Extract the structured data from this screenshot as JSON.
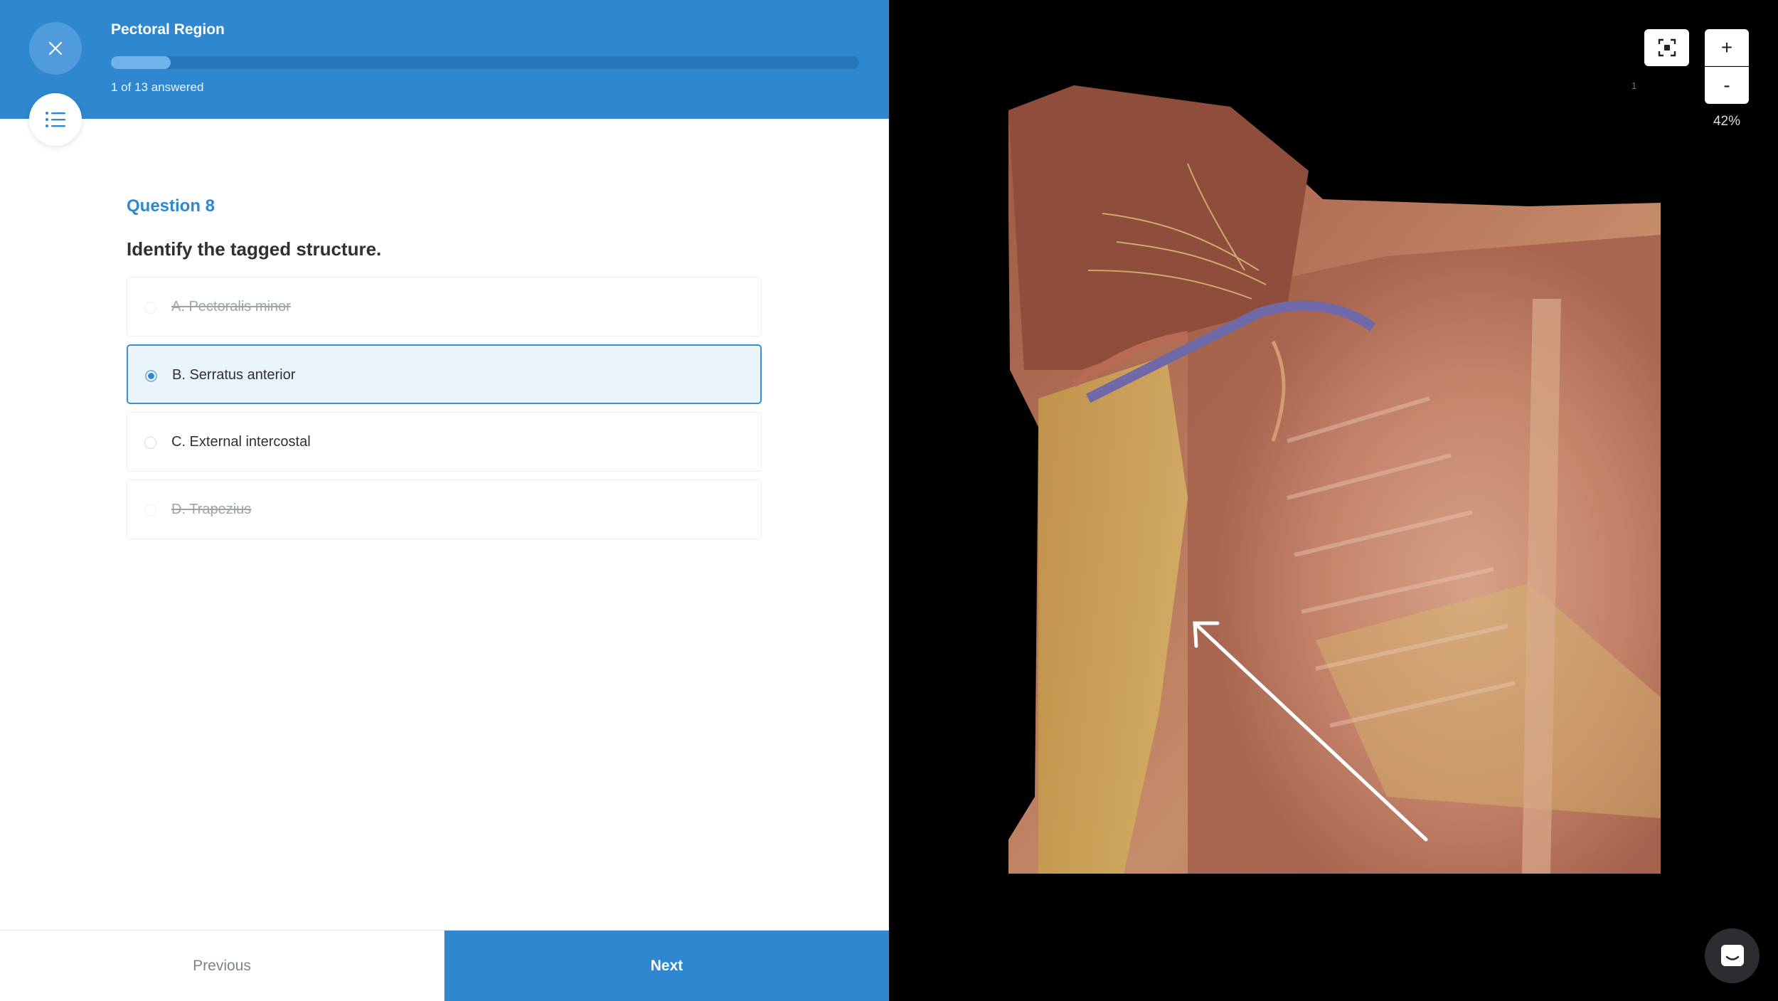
{
  "header": {
    "title": "Pectoral Region",
    "progress_text": "1 of 13 answered",
    "progress_fraction": 0.08
  },
  "question": {
    "number": "Question 8",
    "prompt": "Identify the tagged structure."
  },
  "options": [
    {
      "label": "A. Pectoralis minor",
      "state": "struck"
    },
    {
      "label": "B. Serratus anterior",
      "state": "selected"
    },
    {
      "label": "C. External intercostal",
      "state": "normal"
    },
    {
      "label": "D. Trapezius",
      "state": "struck"
    }
  ],
  "footer": {
    "previous_label": "Previous",
    "next_label": "Next"
  },
  "viewer": {
    "zoom_in_label": "+",
    "zoom_out_label": "-",
    "zoom_level": "42%",
    "page_indicator": "1"
  },
  "colors": {
    "accent": "#2f87d0",
    "selected_bg": "#eaf4fb"
  },
  "icons": {
    "close": "close-icon",
    "question_list": "list-icon",
    "fullscreen": "fullscreen-icon",
    "chat": "chat-icon"
  }
}
